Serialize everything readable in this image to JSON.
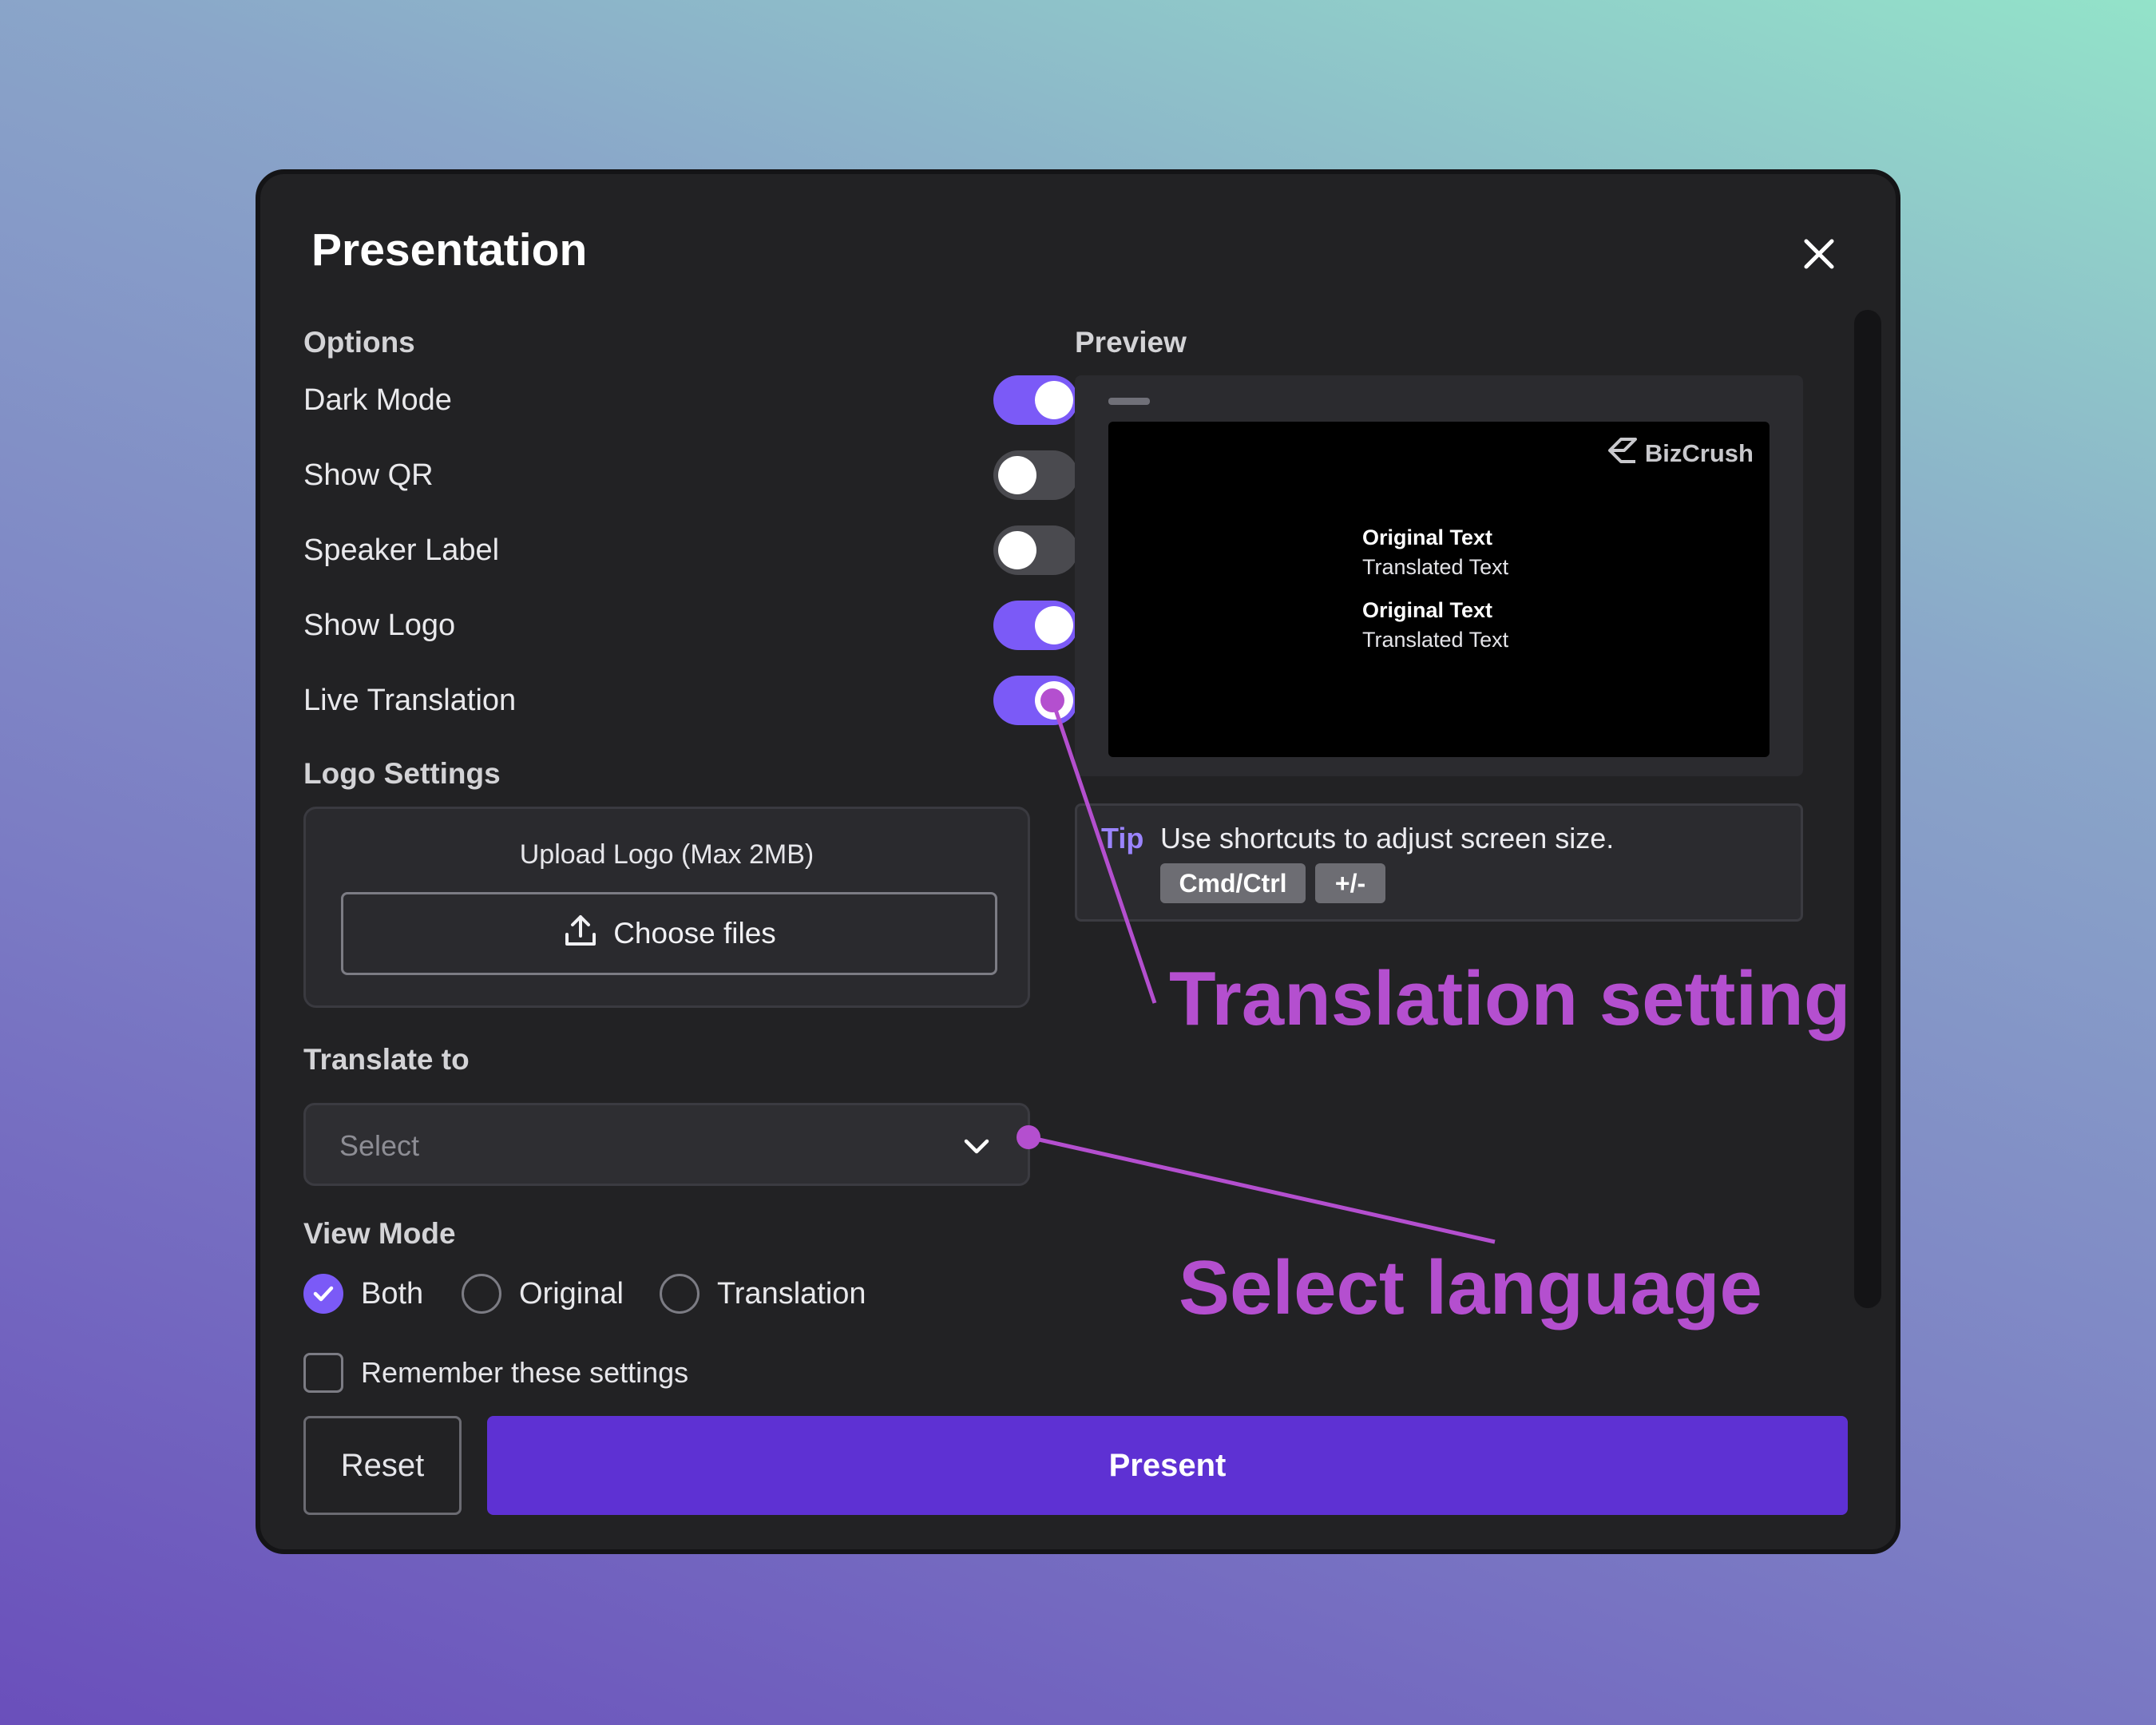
{
  "modal": {
    "title": "Presentation",
    "close_icon": "close-icon"
  },
  "options": {
    "heading": "Options",
    "items": [
      {
        "label": "Dark Mode",
        "enabled": true
      },
      {
        "label": "Show QR",
        "enabled": false
      },
      {
        "label": "Speaker Label",
        "enabled": false
      },
      {
        "label": "Show Logo",
        "enabled": true
      },
      {
        "label": "Live Translation",
        "enabled": true
      }
    ]
  },
  "logo_settings": {
    "heading": "Logo Settings",
    "upload_title": "Upload Logo (Max 2MB)",
    "choose_label": "Choose files",
    "upload_icon": "upload-icon"
  },
  "translate": {
    "heading": "Translate to",
    "placeholder": "Select",
    "chevron_icon": "chevron-down-icon"
  },
  "view_mode": {
    "heading": "View Mode",
    "options": [
      {
        "label": "Both",
        "checked": true
      },
      {
        "label": "Original",
        "checked": false
      },
      {
        "label": "Translation",
        "checked": false
      }
    ]
  },
  "remember": {
    "label": "Remember these settings",
    "checked": false
  },
  "actions": {
    "reset_label": "Reset",
    "present_label": "Present"
  },
  "preview": {
    "heading": "Preview",
    "brand": "BizCrush",
    "lines": [
      {
        "original": "Original Text",
        "translated": "Translated Text"
      },
      {
        "original": "Original Text",
        "translated": "Translated Text"
      }
    ]
  },
  "tip": {
    "label": "Tip",
    "text": "Use shortcuts to adjust screen size.",
    "keys": [
      "Cmd/Ctrl",
      "+/-"
    ]
  },
  "annotations": {
    "translation_setting": "Translation setting",
    "select_language": "Select language"
  },
  "colors": {
    "accent": "#7b5af7",
    "primary_button": "#5e31d3",
    "annotation": "#b44fcf",
    "modal_bg": "#222224"
  }
}
